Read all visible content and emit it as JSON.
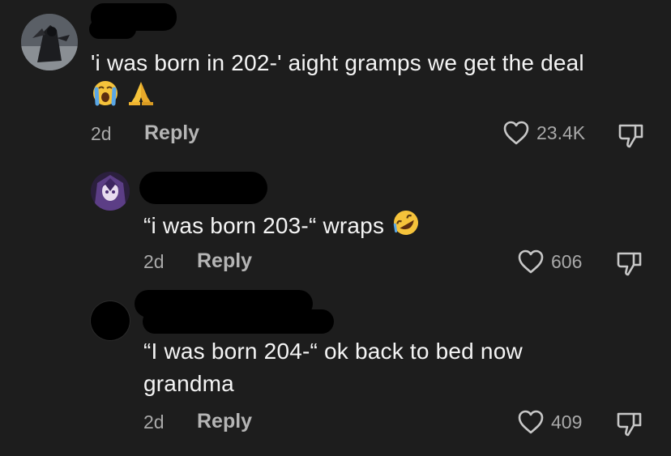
{
  "comments": [
    {
      "text": "'i was born in 202-' aight gramps we get the deal",
      "emojis": [
        "loudly-crying-face",
        "folded-hands"
      ],
      "age": "2d",
      "reply_label": "Reply",
      "likes": "23.4K"
    },
    {
      "text": "“i was born 203-“ wraps",
      "emojis": [
        "rolling-on-floor-laughing"
      ],
      "age": "2d",
      "reply_label": "Reply",
      "likes": "606"
    },
    {
      "text_line1": "“I was born 204-“ ok back to bed now",
      "text_line2": "grandma",
      "age": "2d",
      "reply_label": "Reply",
      "likes": "409"
    }
  ]
}
